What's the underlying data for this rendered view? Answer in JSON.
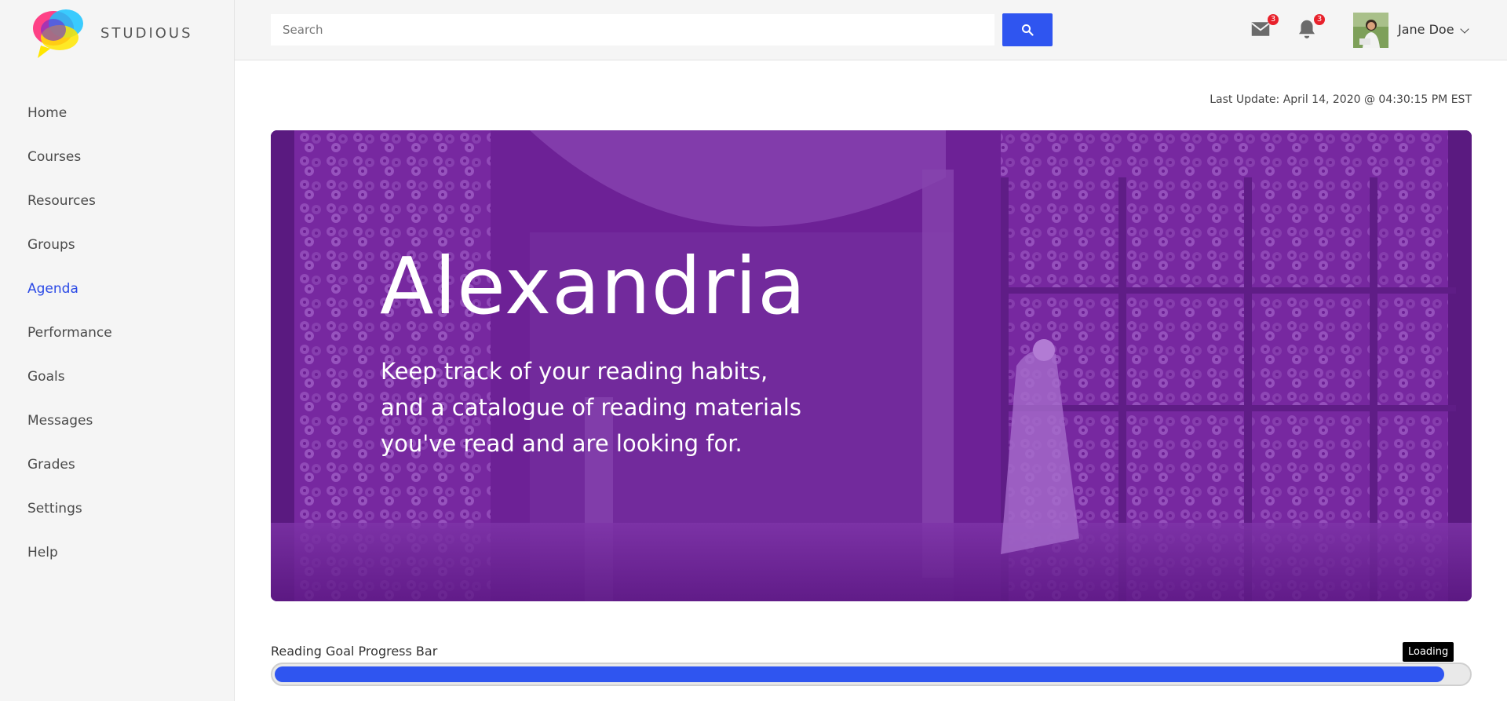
{
  "brand": {
    "name": "STUDIOUS"
  },
  "sidebar": {
    "items": [
      {
        "label": "Home"
      },
      {
        "label": "Courses"
      },
      {
        "label": "Resources"
      },
      {
        "label": "Groups"
      },
      {
        "label": "Agenda",
        "active": true
      },
      {
        "label": "Performance"
      },
      {
        "label": "Goals"
      },
      {
        "label": "Messages"
      },
      {
        "label": "Grades"
      },
      {
        "label": "Settings"
      },
      {
        "label": "Help"
      }
    ],
    "active_color": "#2a49e6"
  },
  "header": {
    "search": {
      "placeholder": "Search",
      "value": ""
    },
    "search_button_icon": "search-icon",
    "mail": {
      "icon": "mail-icon",
      "count": "3"
    },
    "notifications": {
      "icon": "bell-icon",
      "count": "3"
    },
    "user": {
      "name": "Jane Doe ",
      "avatar": "avatar"
    }
  },
  "main": {
    "last_update": "Last Update: April 14, 2020 @ 04:30:15 PM EST",
    "hero": {
      "title": "Alexandria",
      "subtitle_lines": [
        "Keep track of your reading habits,",
        "and a catalogue of reading materials",
        "you've read and are looking for."
      ]
    },
    "progress": {
      "label": "Reading Goal Progress Bar",
      "tooltip": "Loading",
      "percent": 98
    }
  },
  "colors": {
    "accent": "#2f55f0",
    "hero_purple": "#6a1d92",
    "badge_red": "#e8212b"
  }
}
